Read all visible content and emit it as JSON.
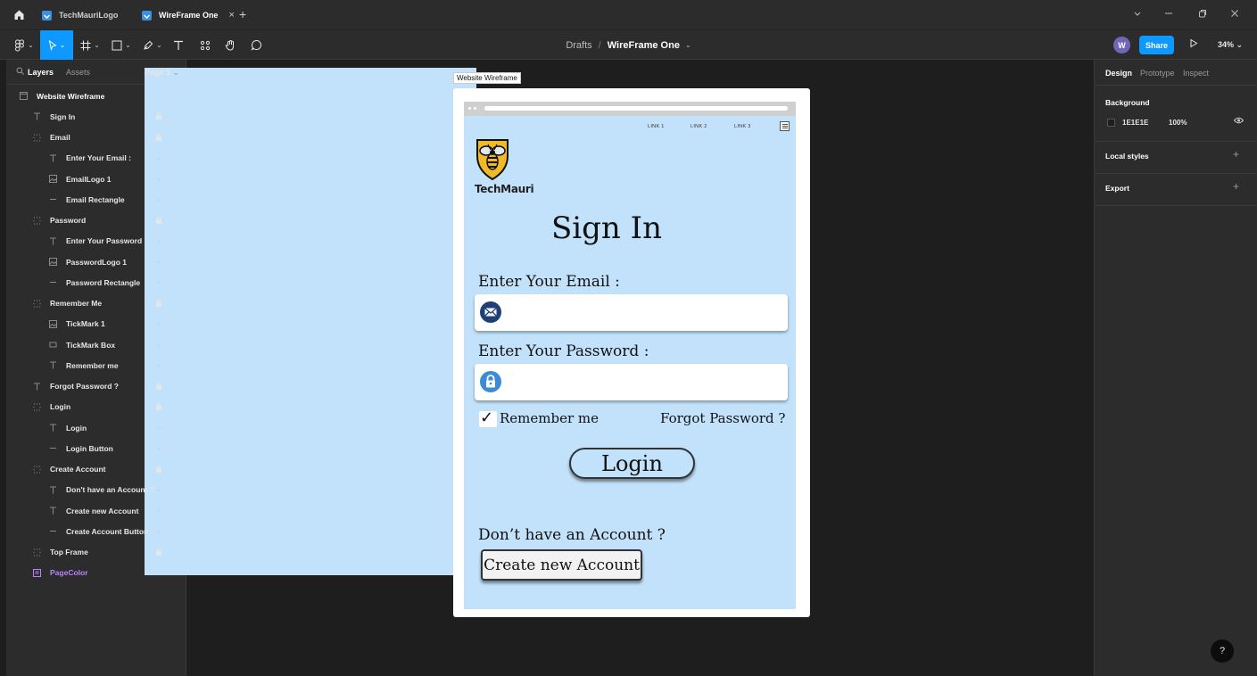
{
  "window": {
    "tabs": [
      {
        "label": "TechMauriLogo",
        "active": false
      },
      {
        "label": "WireFrame One",
        "active": true
      }
    ],
    "new_tab_symbol": "+",
    "close_symbol": "×"
  },
  "toolbar": {
    "breadcrumb_folder": "Drafts",
    "breadcrumb_sep": "/",
    "breadcrumb_file": "WireFrame One",
    "avatar_initial": "W",
    "share_label": "Share",
    "zoom_label": "34%",
    "tools": [
      "main-menu",
      "move",
      "frame",
      "shape",
      "pen",
      "text",
      "resources",
      "hand",
      "comment"
    ]
  },
  "left_panel": {
    "tab_layers": "Layers",
    "tab_assets": "Assets",
    "page_selector": "Page 1",
    "layers": [
      {
        "label": "Website Wireframe",
        "icon": "frame-icon",
        "indent": 0,
        "state": "none"
      },
      {
        "label": "Sign In",
        "icon": "text-icon",
        "indent": 1,
        "state": "lock"
      },
      {
        "label": "Email",
        "icon": "group-icon",
        "indent": 1,
        "state": "lock"
      },
      {
        "label": "Enter Your Email :",
        "icon": "text-icon",
        "indent": 2,
        "state": "dot"
      },
      {
        "label": "EmailLogo 1",
        "icon": "image-icon",
        "indent": 2,
        "state": "dot"
      },
      {
        "label": "Email Rectangle",
        "icon": "line-icon",
        "indent": 2,
        "state": "dot"
      },
      {
        "label": "Password",
        "icon": "group-icon",
        "indent": 1,
        "state": "lock"
      },
      {
        "label": "Enter Your Password :",
        "icon": "text-icon",
        "indent": 2,
        "state": "dot"
      },
      {
        "label": "PasswordLogo 1",
        "icon": "image-icon",
        "indent": 2,
        "state": "dot"
      },
      {
        "label": "Password Rectangle",
        "icon": "line-icon",
        "indent": 2,
        "state": "dot"
      },
      {
        "label": "Remember Me",
        "icon": "group-icon",
        "indent": 1,
        "state": "lock"
      },
      {
        "label": "TickMark 1",
        "icon": "image-icon",
        "indent": 2,
        "state": "dot"
      },
      {
        "label": "TickMark Box",
        "icon": "rect-icon",
        "indent": 2,
        "state": "dot"
      },
      {
        "label": "Remember me",
        "icon": "text-icon",
        "indent": 2,
        "state": "dot"
      },
      {
        "label": "Forgot Password ?",
        "icon": "text-icon",
        "indent": 1,
        "state": "lock"
      },
      {
        "label": "Login",
        "icon": "group-icon",
        "indent": 1,
        "state": "lock"
      },
      {
        "label": "Login",
        "icon": "text-icon",
        "indent": 2,
        "state": "dot"
      },
      {
        "label": "Login Button",
        "icon": "line-icon",
        "indent": 2,
        "state": "dot"
      },
      {
        "label": "Create Account",
        "icon": "group-icon",
        "indent": 1,
        "state": "lock"
      },
      {
        "label": "Don't have an Account ?",
        "icon": "text-icon",
        "indent": 2,
        "state": "dot"
      },
      {
        "label": "Create new Account",
        "icon": "text-icon",
        "indent": 2,
        "state": "dot"
      },
      {
        "label": "Create Account Button",
        "icon": "line-icon",
        "indent": 2,
        "state": "dot"
      },
      {
        "label": "Top Frame",
        "icon": "group-icon",
        "indent": 1,
        "state": "lock"
      },
      {
        "label": "PageColor",
        "icon": "component-icon",
        "indent": 1,
        "state": "none",
        "purple": true
      }
    ]
  },
  "canvas": {
    "frame_label": "Website Wireframe",
    "nav_links": [
      "LINK 1",
      "LINK 2",
      "LINK 3"
    ],
    "logo_text": "TechMauri",
    "title": "Sign In",
    "email_label": "Enter Your Email :",
    "password_label": "Enter Your Password :",
    "tick_symbol": "✓",
    "remember_label": "Remember me",
    "forgot_label": "Forgot Password ?",
    "login_label": "Login",
    "no_account_label": "Don’t have an Account ?",
    "create_label": "Create new Account",
    "page_color": "#c2e2fb"
  },
  "right_panel": {
    "tabs": [
      "Design",
      "Prototype",
      "Inspect"
    ],
    "background_title": "Background",
    "background_hex": "1E1E1E",
    "background_opacity": "100%",
    "local_styles_title": "Local styles",
    "export_title": "Export"
  },
  "help_symbol": "?"
}
